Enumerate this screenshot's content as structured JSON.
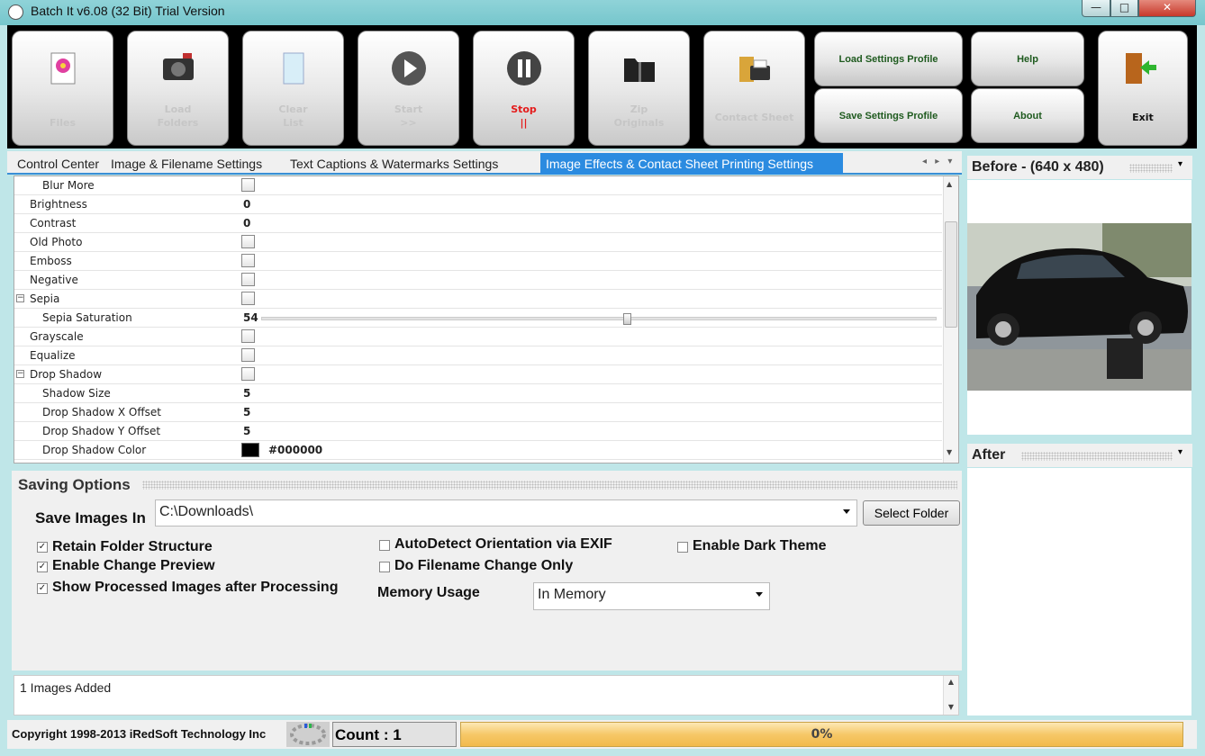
{
  "window": {
    "title": "Batch It v6.08 (32 Bit) Trial Version",
    "min_glyph": "—",
    "max_glyph": "□",
    "close_glyph": "✕"
  },
  "toolbar": {
    "files": [
      "",
      "Files"
    ],
    "load_folders": [
      "Load",
      "Folders"
    ],
    "clear_list": [
      "Clear",
      "List"
    ],
    "start": [
      "Start",
      ">>"
    ],
    "stop": [
      "Stop",
      "||"
    ],
    "zip_originals": [
      "Zip",
      "Originals"
    ],
    "contact_sheet": "Contact Sheet",
    "load_settings_profile": "Load Settings Profile",
    "save_settings_profile": "Save Settings Profile",
    "help": "Help",
    "about": "About",
    "exit": "Exit",
    "stop_color": "#e41b1b"
  },
  "tabs": {
    "t1": "Control Center",
    "t2": "Image & Filename Settings",
    "t3": "Text Captions & Watermarks Settings",
    "t4": "Image Effects & Contact Sheet Printing Settings",
    "nav": "◂ ▸ ▾"
  },
  "grid": {
    "rows": [
      {
        "name": "Blur More",
        "sub": true,
        "type": "check",
        "value": ""
      },
      {
        "name": "Brightness",
        "sub": false,
        "type": "text",
        "value": "0"
      },
      {
        "name": "Contrast",
        "sub": false,
        "type": "text",
        "value": "0"
      },
      {
        "name": "Old Photo",
        "sub": false,
        "type": "check",
        "value": ""
      },
      {
        "name": "Emboss",
        "sub": false,
        "type": "check",
        "value": ""
      },
      {
        "name": "Negative",
        "sub": false,
        "type": "check",
        "value": ""
      },
      {
        "name": "Sepia",
        "sub": false,
        "type": "check",
        "value": "",
        "expander": "−"
      },
      {
        "name": "Sepia Saturation",
        "sub": true,
        "type": "slider",
        "value": "54",
        "slider_fraction": 0.54
      },
      {
        "name": "Grayscale",
        "sub": false,
        "type": "check",
        "value": ""
      },
      {
        "name": "Equalize",
        "sub": false,
        "type": "check",
        "value": ""
      },
      {
        "name": "Drop Shadow",
        "sub": false,
        "type": "check",
        "value": "",
        "expander": "−"
      },
      {
        "name": "Shadow Size",
        "sub": true,
        "type": "text",
        "value": "5"
      },
      {
        "name": "Drop Shadow X Offset",
        "sub": true,
        "type": "text",
        "value": "5"
      },
      {
        "name": "Drop Shadow Y Offset",
        "sub": true,
        "type": "text",
        "value": "5"
      },
      {
        "name": "Drop Shadow Color",
        "sub": true,
        "type": "color",
        "value": "#000000",
        "swatch": "#000000"
      }
    ]
  },
  "preview": {
    "before": "Before - (640 x 480)",
    "after": "After"
  },
  "saving": {
    "title": "Saving Options",
    "save_images_in_label": "Save Images In",
    "path": "C:\\Downloads\\",
    "select_folder": "Select Folder",
    "retain_folder_structure": "Retain Folder Structure",
    "enable_change_preview": "Enable Change Preview",
    "show_processed": "Show Processed Images after Processing",
    "autodetect": "AutoDetect Orientation via EXIF",
    "filename_only": "Do Filename Change Only",
    "dark_theme": "Enable Dark Theme",
    "memory_usage_label": "Memory Usage",
    "memory_usage_value": "In Memory",
    "checked_glyph": "✓"
  },
  "log": {
    "text": "1 Images Added"
  },
  "status": {
    "copyright": "Copyright 1998-2013 iRedSoft Technology Inc",
    "count": "Count : 1",
    "progress": "0%"
  }
}
